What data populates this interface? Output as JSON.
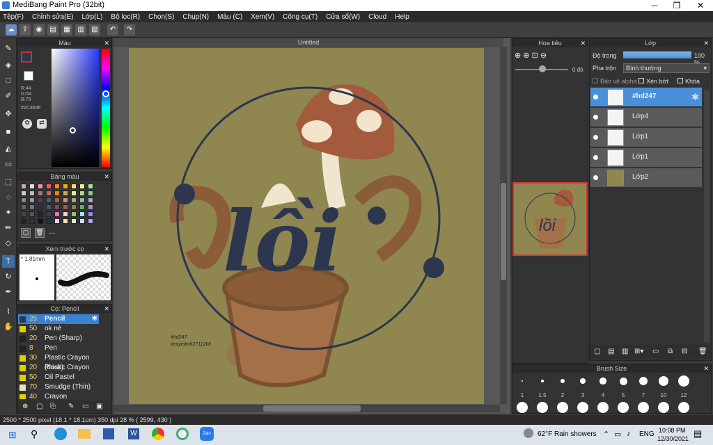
{
  "window": {
    "title": "MediBang Paint Pro (32bit)",
    "min": "─",
    "max": "❐",
    "close": "✕"
  },
  "menu": [
    "Tệp(F)",
    "Chỉnh sửa(E)",
    "Lớp(L)",
    "Bộ lọc(R)",
    "Chọn(S)",
    "Chụp(N)",
    "Màu (C)",
    "Xem(V)",
    "Công cụ(T)",
    "Cửa sổ(W)",
    "Cloud",
    "Help"
  ],
  "color_panel": {
    "title": "Màu",
    "r": "R:44",
    "g": "G:54",
    "b": "B:79",
    "hex": "#2C364F",
    "current": "#2C364F"
  },
  "palette_panel": {
    "title": "Bảng màu",
    "more": "---"
  },
  "preview_panel": {
    "title": "Xem trước cọ",
    "size": "1.81mm"
  },
  "brush_panel": {
    "title": "Cọ: Pencil",
    "items": [
      {
        "size": "25",
        "name": "Pencil",
        "color": "#2c364f"
      },
      {
        "size": "50",
        "name": "ok nè",
        "color": "#e0d000"
      },
      {
        "size": "20",
        "name": "Pen (Sharp)",
        "color": "#222"
      },
      {
        "size": "8",
        "name": "Pen",
        "color": "#222"
      },
      {
        "size": "30",
        "name": "Plastic Crayon (thick)",
        "color": "#e0d000"
      },
      {
        "size": "20",
        "name": "Plastic Crayon",
        "color": "#e0d000"
      },
      {
        "size": "50",
        "name": "Oil Pastel",
        "color": "#e0d000"
      },
      {
        "size": "70",
        "name": "Smudge (Thin)",
        "color": "#f0e0c0"
      },
      {
        "size": "40",
        "name": "Crayon",
        "color": "#e0d000"
      }
    ]
  },
  "document": {
    "tab": "Untitled",
    "signature1": "#hd247",
    "signature2": "tieuyeitinh27112k6"
  },
  "navigator": {
    "title": "Hoa tiêu",
    "angle": "0 độ"
  },
  "layers_panel": {
    "title": "Lớp",
    "opacity_label": "Độ trong",
    "opacity_value": "100 %",
    "blend_label": "Pha trộn",
    "blend_value": "Bình thường",
    "protect_alpha": "Bảo vệ alpha",
    "clipping": "Xén bớt",
    "lock": "Khóa",
    "layers": [
      {
        "name": "#hd247",
        "selected": true
      },
      {
        "name": "Lớp4",
        "selected": false
      },
      {
        "name": "Lớp1",
        "selected": false
      },
      {
        "name": "Lớp1",
        "selected": false
      },
      {
        "name": "Lớp2",
        "selected": false
      }
    ]
  },
  "brush_size_panel": {
    "title": "Brush Size",
    "sizes": [
      "1",
      "1.5",
      "2",
      "3",
      "4",
      "5",
      "7",
      "10",
      "12"
    ]
  },
  "status": {
    "text": "2500 * 2500 pixel  (18.1 * 18.1cm)  350 dpi  28 %  ( 2599, 430 )"
  },
  "taskbar": {
    "weather": "62°F  Rain showers",
    "lang": "ENG",
    "time": "10:08 PM",
    "date": "12/30/2021",
    "zalo": "Zalo"
  }
}
